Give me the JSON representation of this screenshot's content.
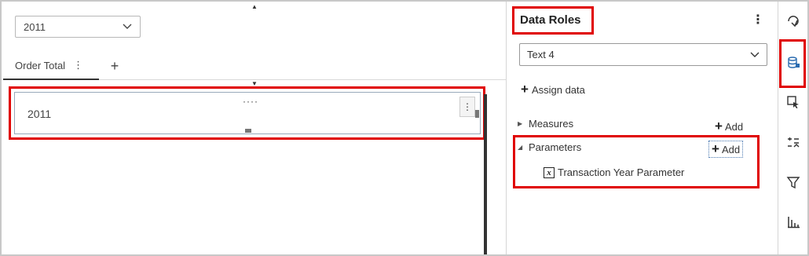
{
  "canvas": {
    "year_select": {
      "value": "2011"
    },
    "tabs": [
      {
        "label": "Order Total",
        "menu_glyph": "⋮"
      }
    ],
    "add_tab_glyph": "+",
    "object": {
      "value": "2011",
      "drag_glyph": "····",
      "menu_glyph": "⋮"
    },
    "caret_glyph": "▲",
    "caret_down_glyph": "▼"
  },
  "pane": {
    "title": "Data Roles",
    "menu_glyph": "⋮",
    "object_select": {
      "value": "Text 4"
    },
    "assign_label": "Assign data",
    "measures": {
      "label": "Measures",
      "add_label": "Add",
      "expanded": false
    },
    "parameters": {
      "label": "Parameters",
      "add_label": "Add",
      "expanded": true,
      "items": [
        {
          "label": "Transaction Year Parameter",
          "icon": "parameter-x-icon"
        }
      ]
    },
    "collapsed_glyph": "▶",
    "expanded_glyph": "◢",
    "plus_glyph": "+"
  },
  "rail": {
    "items": [
      {
        "name": "options-icon",
        "active": false
      },
      {
        "name": "data-roles-icon",
        "active": true
      },
      {
        "name": "actions-icon",
        "active": false
      },
      {
        "name": "rules-icon",
        "active": false
      },
      {
        "name": "filters-icon",
        "active": false
      },
      {
        "name": "ranks-icon",
        "active": false
      }
    ]
  },
  "colors": {
    "highlight": "#e00000",
    "accent": "#2b6cb0"
  }
}
